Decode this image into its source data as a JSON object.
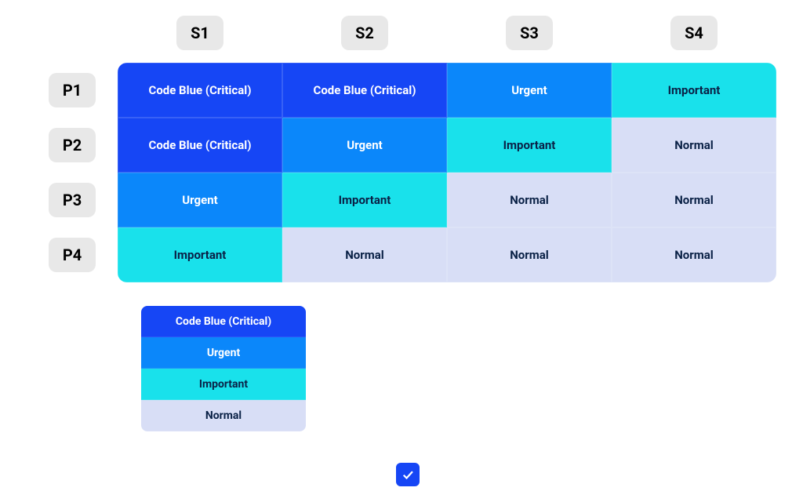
{
  "columns": [
    "S1",
    "S2",
    "S3",
    "S4"
  ],
  "rows": [
    "P1",
    "P2",
    "P3",
    "P4"
  ],
  "levels": {
    "critical": {
      "label": "Code Blue (Critical)",
      "class": "lvl-critical"
    },
    "urgent": {
      "label": "Urgent",
      "class": "lvl-urgent"
    },
    "important": {
      "label": "Important",
      "class": "lvl-important"
    },
    "normal": {
      "label": "Normal",
      "class": "lvl-normal"
    }
  },
  "matrix": [
    [
      "critical",
      "critical",
      "urgent",
      "important"
    ],
    [
      "critical",
      "urgent",
      "important",
      "normal"
    ],
    [
      "urgent",
      "important",
      "normal",
      "normal"
    ],
    [
      "important",
      "normal",
      "normal",
      "normal"
    ]
  ],
  "legend_order": [
    "critical",
    "urgent",
    "important",
    "normal"
  ],
  "colors": {
    "critical": "#1646F5",
    "urgent": "#0B87FA",
    "important": "#19E1EB",
    "normal": "#D8DEF6",
    "header_bg": "#E8E8E8"
  }
}
